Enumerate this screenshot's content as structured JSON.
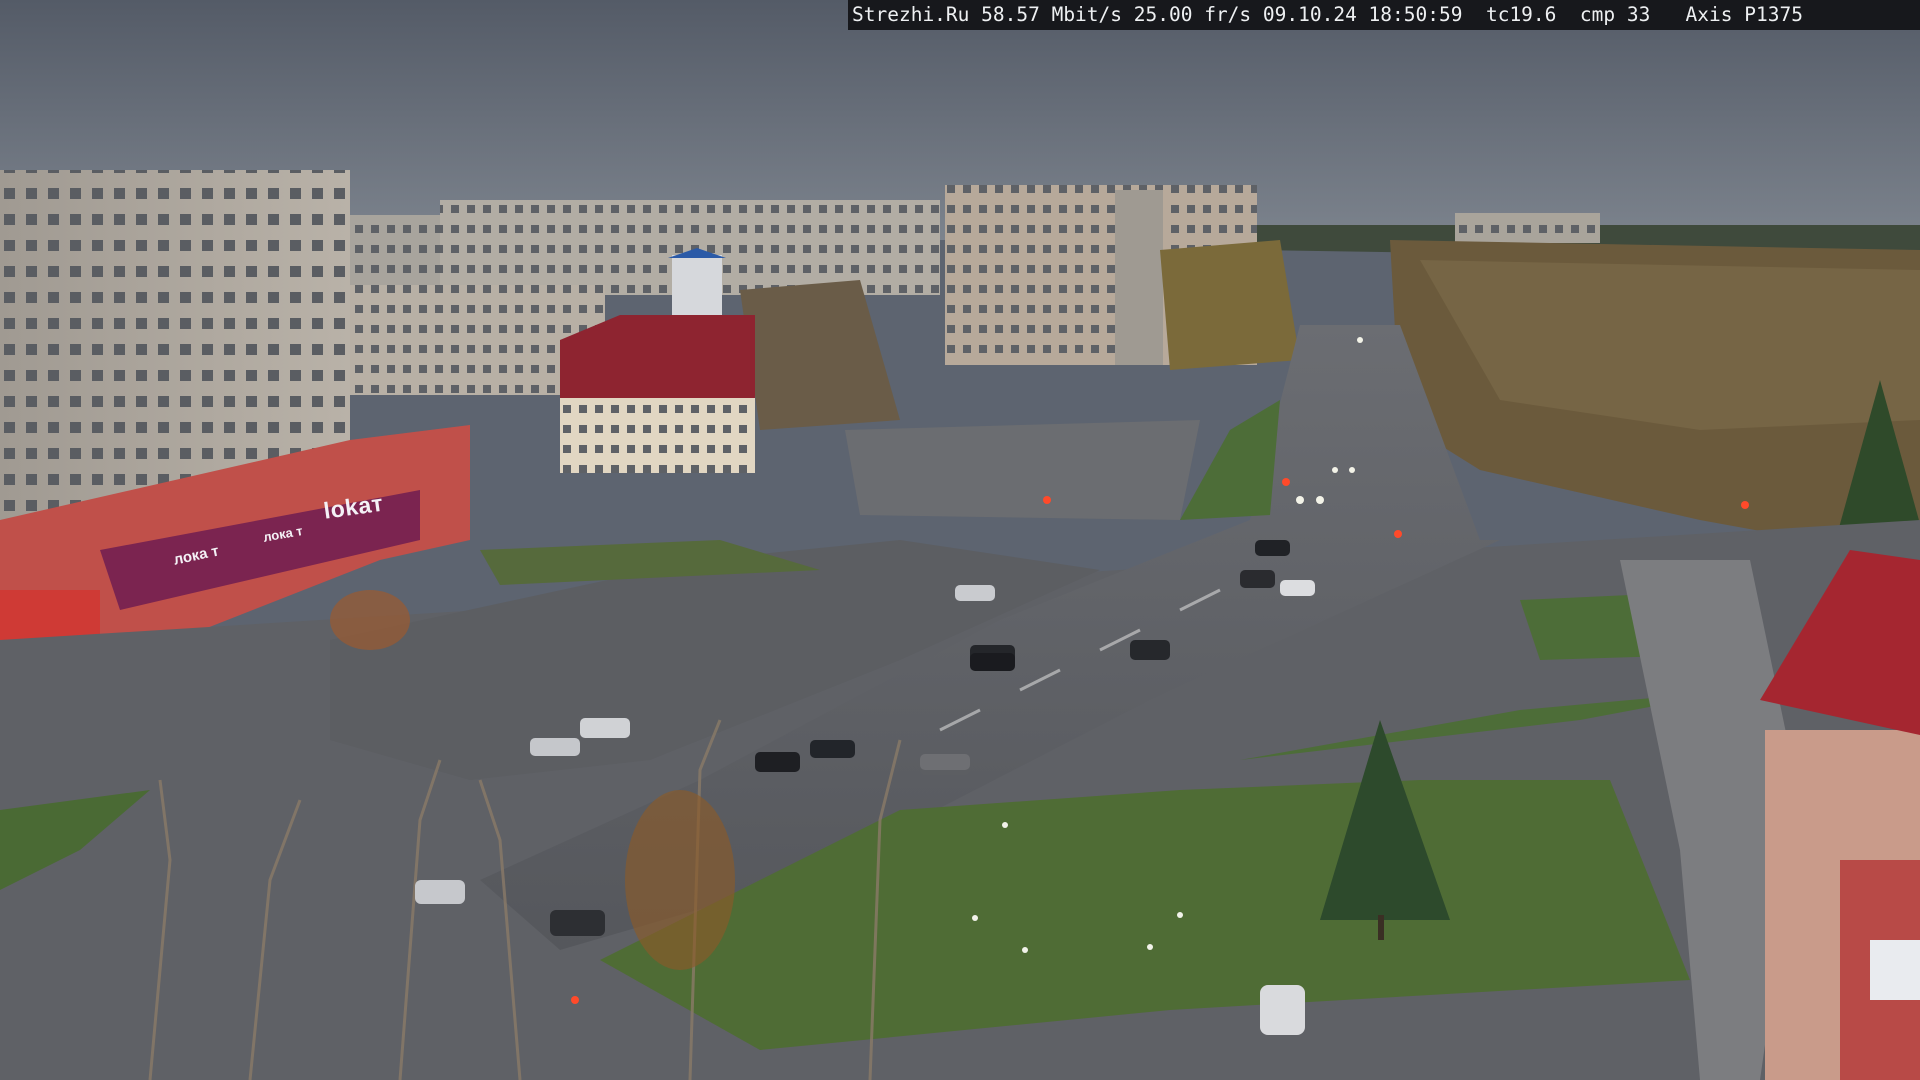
{
  "overlay": {
    "text": "Strezhi.Ru 58.57 Mbit/s 25.00 fr/s 09.10.24 18:50:59  tc19.6  cmp 33   Axis P1375"
  },
  "signs": {
    "store_big": "lokaт",
    "store_mid": "лока т",
    "store_small": "лока т"
  },
  "scene": {
    "description_icon": "street-webcam-view"
  },
  "colors": {
    "sky": "#5e6672",
    "road": "#5a5c61",
    "grass": "#4c6a33",
    "accent_building": "#a02a2e"
  }
}
